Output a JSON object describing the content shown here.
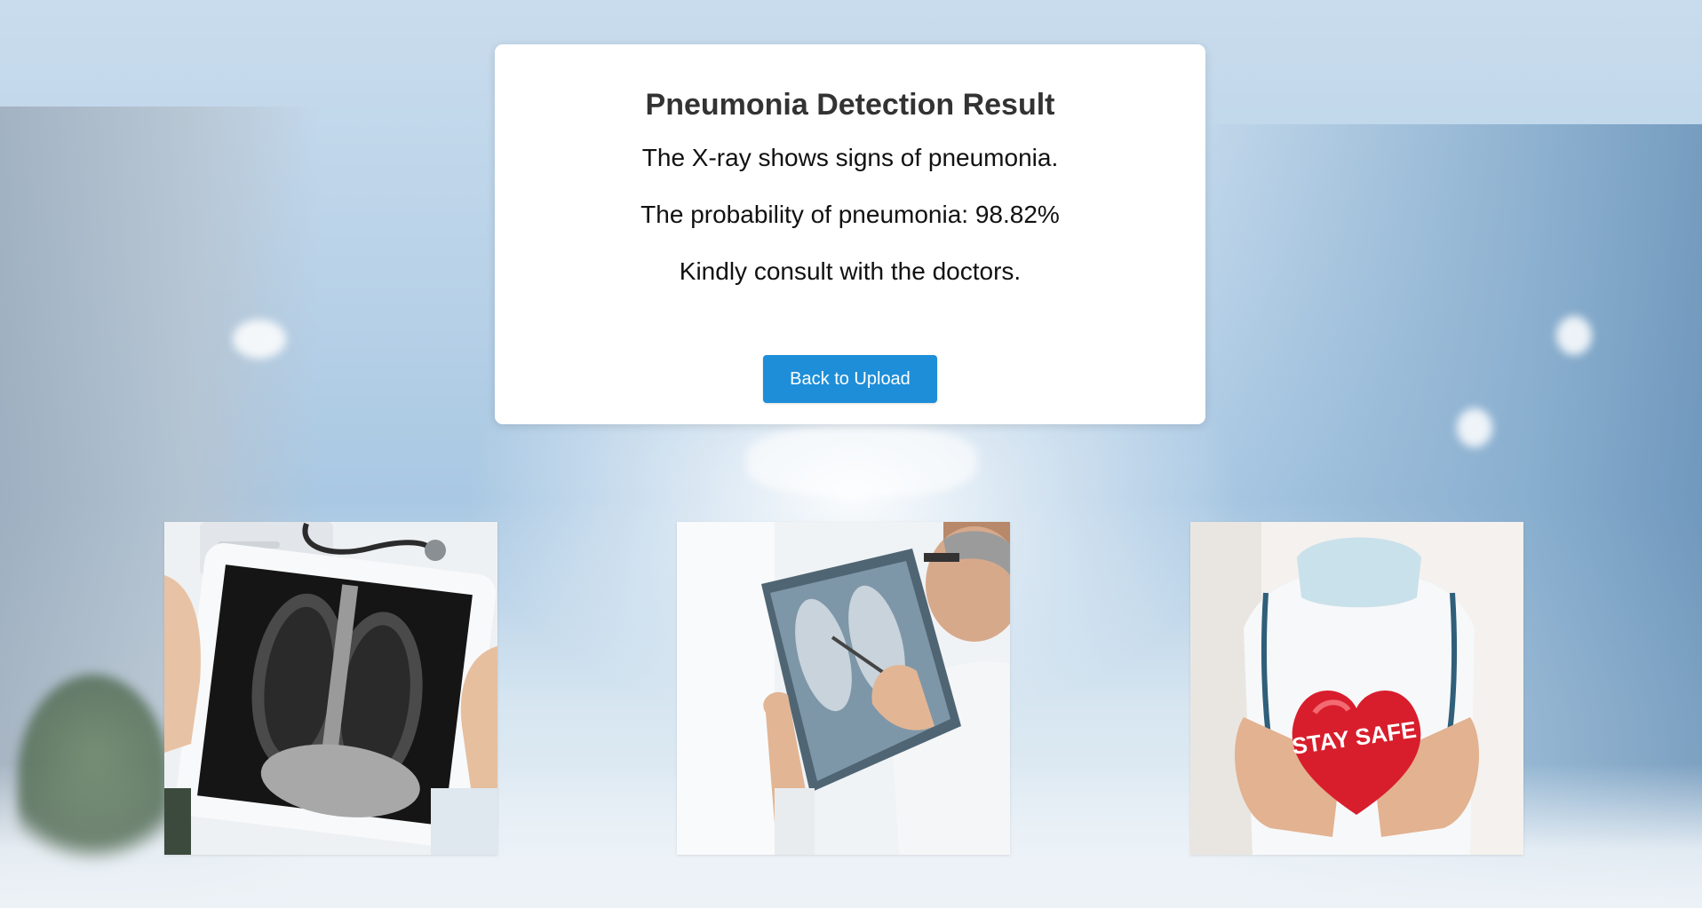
{
  "result": {
    "title": "Pneumonia Detection Result",
    "line1": "The X-ray shows signs of pneumonia.",
    "line2": "The probability of pneumonia: 98.82%",
    "line3": "Kindly consult with the doctors.",
    "button_label": "Back to Upload"
  },
  "images": {
    "sign_text": "STAY SAFE"
  },
  "colors": {
    "button": "#1e8ed8",
    "card": "#ffffff",
    "heart": "#d81e2c"
  }
}
